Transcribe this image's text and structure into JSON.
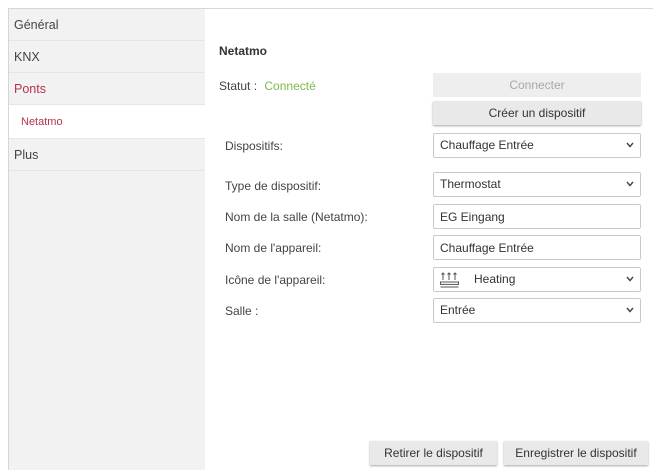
{
  "sidebar": {
    "items": [
      {
        "label": "Général"
      },
      {
        "label": "KNX"
      },
      {
        "label": "Ponts",
        "active": true
      },
      {
        "label": "Netatmo",
        "sub": true
      },
      {
        "label": "Plus"
      }
    ]
  },
  "main": {
    "title": "Netatmo",
    "status_label": "Statut :",
    "status_value": "Connecté",
    "connect_label": "Connecter",
    "create_label": "Créer un dispositif",
    "form": {
      "devices_label": "Dispositifs:",
      "devices_value": "Chauffage Entrée",
      "type_label": "Type de dispositif:",
      "type_value": "Thermostat",
      "room_netatmo_label": "Nom de la salle (Netatmo):",
      "room_netatmo_value": "EG Eingang",
      "device_name_label": "Nom de l'appareil:",
      "device_name_value": "Chauffage Entrée",
      "icon_label": "Icône de l'appareil:",
      "icon_value": "Heating",
      "icon_name": "heating-icon",
      "room_label": "Salle :",
      "room_value": "Entrée"
    },
    "remove_label": "Retirer le dispositif",
    "save_label": "Enregistrer le dispositif"
  },
  "colors": {
    "accent": "#b4354a",
    "connected": "#7cba4a",
    "sidebar_bg": "#f2f2f2",
    "button_bg": "#e9e9e9"
  }
}
